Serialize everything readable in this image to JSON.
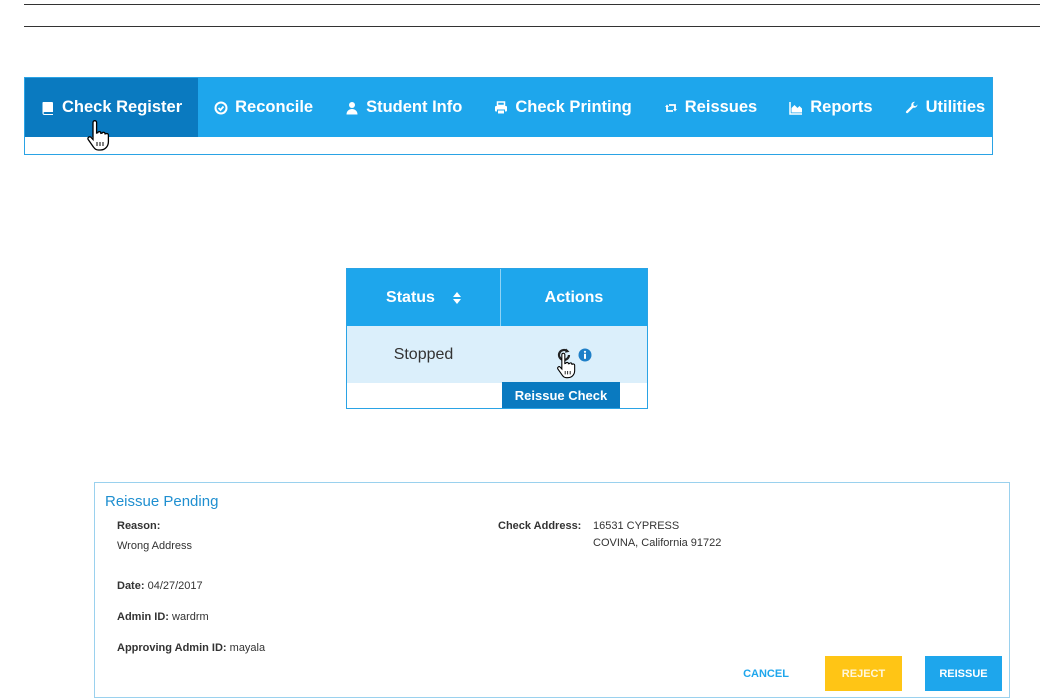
{
  "nav": {
    "items": [
      {
        "label": "Check Register",
        "icon": "book-icon",
        "active": true
      },
      {
        "label": "Reconcile",
        "icon": "check-circle-icon"
      },
      {
        "label": "Student Info",
        "icon": "user-icon"
      },
      {
        "label": "Check Printing",
        "icon": "printer-icon"
      },
      {
        "label": "Reissues",
        "icon": "retweet-icon"
      },
      {
        "label": "Reports",
        "icon": "area-chart-icon"
      },
      {
        "label": "Utilities",
        "icon": "wrench-icon"
      }
    ]
  },
  "table": {
    "headers": {
      "status": "Status",
      "actions": "Actions"
    },
    "row": {
      "status": "Stopped"
    },
    "tooltip": "Reissue Check"
  },
  "reissue": {
    "title": "Reissue Pending",
    "reason_label": "Reason:",
    "reason_value": "Wrong Address",
    "address_label": "Check Address:",
    "address_line1": "16531 CYPRESS",
    "address_line2": "COVINA, California 91722",
    "date_label": "Date:",
    "date_value": "04/27/2017",
    "admin_label": "Admin ID:",
    "admin_value": "wardrm",
    "approver_label": "Approving Admin ID:",
    "approver_value": "mayala",
    "buttons": {
      "cancel": "CANCEL",
      "reject": "REJECT",
      "reissue": "REISSUE"
    }
  },
  "colors": {
    "nav_blue": "#1ea6ec",
    "nav_active": "#0a7ac0",
    "row_tint": "#dbeffb",
    "reject_yellow": "#ffc515"
  }
}
